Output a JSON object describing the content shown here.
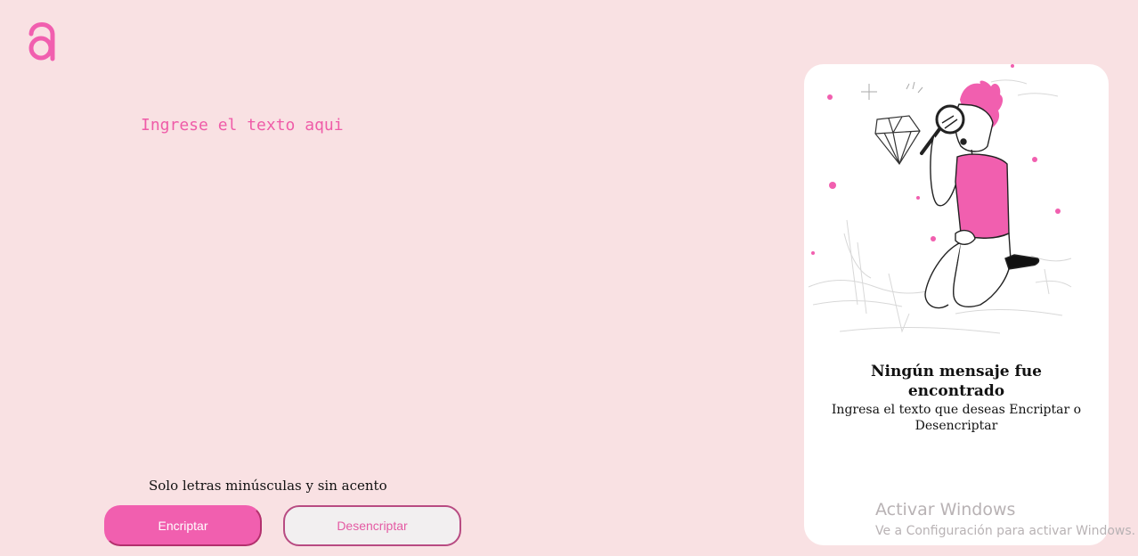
{
  "logo": {
    "icon": "alura-a-logo-icon",
    "color": "#f15faf"
  },
  "input": {
    "placeholder": "Ingrese el texto aqui",
    "value": ""
  },
  "hint": {
    "text": "Solo letras minúsculas y sin acento"
  },
  "buttons": {
    "encrypt_label": "Encriptar",
    "decrypt_label": "Desencriptar"
  },
  "panel": {
    "illustration": "person-with-magnifying-glass-and-diamond-illustration",
    "title": "Ningún mensaje fue encontrado",
    "text": "Ingresa el texto que deseas Encriptar o Desencriptar"
  },
  "watermark": {
    "title": "Activar Windows",
    "subtitle": "Ve a Configuración para activar Windows."
  },
  "colors": {
    "background": "#f9e1e3",
    "accent": "#f15faf",
    "panel": "#ffffff"
  }
}
